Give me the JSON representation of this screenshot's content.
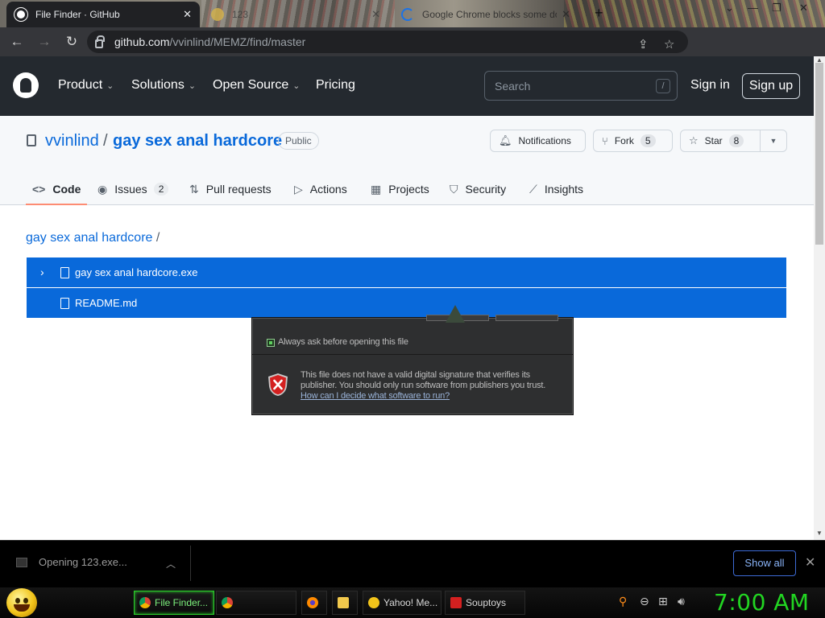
{
  "browser": {
    "tabs": [
      {
        "title": "File Finder · GitHub",
        "close": "✕"
      },
      {
        "title": "123",
        "close": "✕"
      },
      {
        "title": "Google Chrome blocks some do",
        "close": "✕"
      }
    ],
    "new_tab": "+",
    "window_controls": {
      "chevron": "⌄",
      "minimize": "—",
      "restore": "❐",
      "close": "✕"
    },
    "url_host": "github.com",
    "url_path": "/vvinlind/MEMZ/find/master"
  },
  "github": {
    "nav": [
      "Product",
      "Solutions",
      "Open Source",
      "Pricing"
    ],
    "search_placeholder": "Search",
    "search_shortcut": "/",
    "sign_in": "Sign in",
    "sign_up": "Sign up"
  },
  "repo": {
    "owner": "vvinlind",
    "separator": "/",
    "name": "gay sex anal hardcore",
    "visibility": "Public",
    "notifications_label": "Notifications",
    "fork_label": "Fork",
    "fork_count": "5",
    "star_label": "Star",
    "star_count": "8",
    "tabs": [
      {
        "label": "Code",
        "icon": "code-icon"
      },
      {
        "label": "Issues",
        "icon": "issue-icon",
        "count": "2"
      },
      {
        "label": "Pull requests",
        "icon": "pull-request-icon"
      },
      {
        "label": "Actions",
        "icon": "play-icon"
      },
      {
        "label": "Projects",
        "icon": "table-icon"
      },
      {
        "label": "Security",
        "icon": "shield-icon"
      },
      {
        "label": "Insights",
        "icon": "graph-icon"
      }
    ]
  },
  "finder": {
    "breadcrumb": "gay sex anal hardcore",
    "breadcrumb_sep": "/",
    "files": [
      {
        "name": "gay sex anal hardcore.exe",
        "expand": "›"
      },
      {
        "name": "README.md"
      }
    ]
  },
  "dialog": {
    "checkbox_label": "Always ask before opening this file",
    "warning_text": "This file does not have a valid digital signature that verifies its publisher.  You should only run software from publishers you trust.",
    "link": "How can I decide what software to run?"
  },
  "download_bar": {
    "item": "Opening 123.exe...",
    "show_all": "Show all",
    "close": "✕"
  },
  "taskbar": {
    "buttons": [
      {
        "label": "File Finder..."
      },
      {
        "label": ""
      },
      {
        "label": ""
      },
      {
        "label": ""
      },
      {
        "label": "Yahoo! Me..."
      },
      {
        "label": "Souptoys"
      }
    ],
    "clock": "7:00 AM"
  },
  "colors": {
    "github_dark": "#24292f",
    "github_blue": "#0969da",
    "selection_blue": "#0969da",
    "clock_green": "#22d522",
    "tab_underline": "#fd8c73"
  }
}
